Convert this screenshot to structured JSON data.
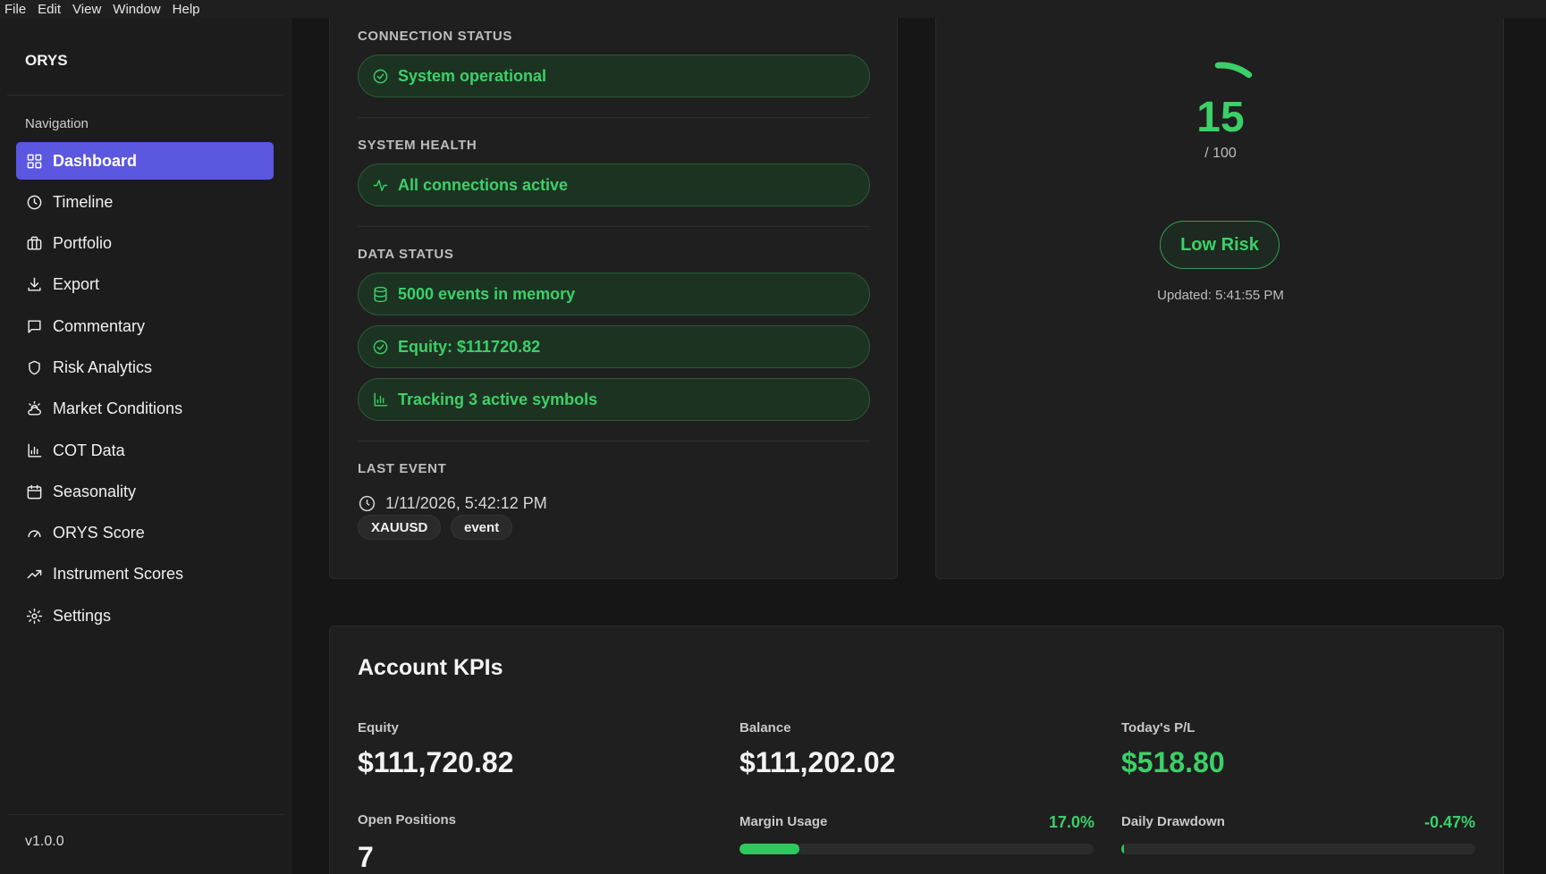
{
  "menu": [
    "File",
    "Edit",
    "View",
    "Window",
    "Help"
  ],
  "sidebar": {
    "brand": "ORYS",
    "nav_heading": "Navigation",
    "items": [
      {
        "label": "Dashboard",
        "icon": "grid-icon",
        "active": true
      },
      {
        "label": "Timeline",
        "icon": "clock-icon"
      },
      {
        "label": "Portfolio",
        "icon": "briefcase-icon"
      },
      {
        "label": "Export",
        "icon": "download-icon"
      },
      {
        "label": "Commentary",
        "icon": "message-icon"
      },
      {
        "label": "Risk Analytics",
        "icon": "shield-icon"
      },
      {
        "label": "Market Conditions",
        "icon": "cloud-sun-icon"
      },
      {
        "label": "COT Data",
        "icon": "bar-chart-icon"
      },
      {
        "label": "Seasonality",
        "icon": "calendar-icon"
      },
      {
        "label": "ORYS Score",
        "icon": "gauge-icon"
      },
      {
        "label": "Instrument Scores",
        "icon": "trending-up-icon"
      },
      {
        "label": "Settings",
        "icon": "gear-icon"
      }
    ],
    "version": "v1.0.0"
  },
  "status": {
    "connection_label": "CONNECTION STATUS",
    "connection_value": "System operational",
    "health_label": "SYSTEM HEALTH",
    "health_value": "All connections active",
    "data_label": "DATA STATUS",
    "data_events": "5000 events in memory",
    "data_equity": "Equity: $111720.82",
    "data_symbols": "Tracking 3 active symbols",
    "last_event_label": "LAST EVENT",
    "last_event_time": "1/11/2026, 5:42:12 PM",
    "tags": [
      "XAUUSD",
      "event"
    ]
  },
  "score": {
    "value": "15",
    "max": "/ 100",
    "level": 0.15,
    "risk_label": "Low Risk",
    "updated": "Updated: 5:41:55 PM",
    "accent": "#3cd069"
  },
  "kpis": {
    "title": "Account KPIs",
    "equity_label": "Equity",
    "equity_value": "$111,720.82",
    "balance_label": "Balance",
    "balance_value": "$111,202.02",
    "pl_label": "Today's P/L",
    "pl_value": "$518.80",
    "positions_label": "Open Positions",
    "positions_value": "7",
    "margin_label": "Margin Usage",
    "margin_pct": "17.0%",
    "margin_level": 0.17,
    "drawdown_label": "Daily Drawdown",
    "drawdown_pct": "-0.47%",
    "drawdown_level": 0.0047
  },
  "colors": {
    "accent_green": "#3cd069",
    "active_nav": "#5b57e0",
    "background": "#161616"
  }
}
